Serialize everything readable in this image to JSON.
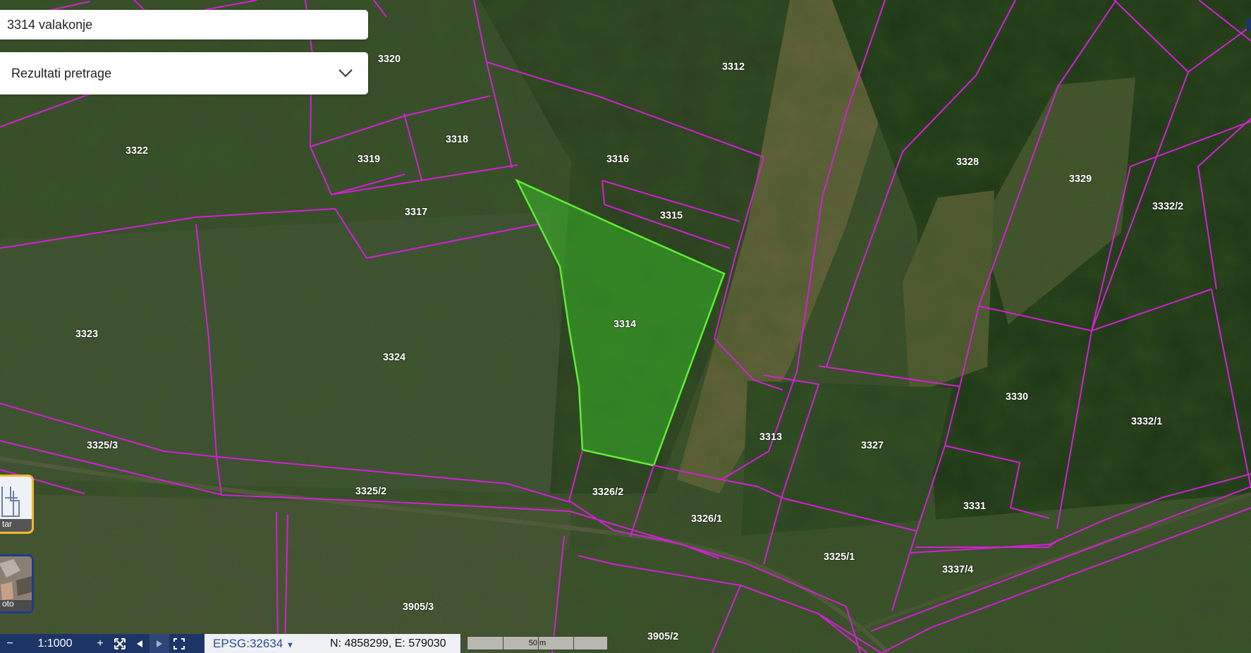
{
  "search": {
    "value": "3314 valakonje"
  },
  "results": {
    "label": "Rezultati pretrage",
    "icon": "chevron-down-icon"
  },
  "parcels": [
    {
      "id": "3320",
      "selected": false
    },
    {
      "id": "3312",
      "selected": false
    },
    {
      "id": "3322",
      "selected": false
    },
    {
      "id": "3318",
      "selected": false
    },
    {
      "id": "3319",
      "selected": false
    },
    {
      "id": "3316",
      "selected": false
    },
    {
      "id": "3328",
      "selected": false
    },
    {
      "id": "3329",
      "selected": false
    },
    {
      "id": "3317",
      "selected": false
    },
    {
      "id": "3315",
      "selected": false
    },
    {
      "id": "3332/2",
      "selected": false
    },
    {
      "id": "3314",
      "selected": true
    },
    {
      "id": "3323",
      "selected": false
    },
    {
      "id": "3324",
      "selected": false
    },
    {
      "id": "3330",
      "selected": false
    },
    {
      "id": "3332/1",
      "selected": false
    },
    {
      "id": "3313",
      "selected": false
    },
    {
      "id": "3325/3",
      "selected": false
    },
    {
      "id": "3327",
      "selected": false
    },
    {
      "id": "3325/2",
      "selected": false
    },
    {
      "id": "3326/2",
      "selected": false
    },
    {
      "id": "3331",
      "selected": false
    },
    {
      "id": "3326/1",
      "selected": false
    },
    {
      "id": "3325/1",
      "selected": false
    },
    {
      "id": "3337/4",
      "selected": false
    },
    {
      "id": "3905/3",
      "selected": false
    },
    {
      "id": "3905/2",
      "selected": false
    }
  ],
  "layers": [
    {
      "label": "tar",
      "active": true
    },
    {
      "label": "oto",
      "active": false
    }
  ],
  "toolbar": {
    "zoom_out": "−",
    "scale": "1:1000",
    "zoom_in": "+",
    "fit": "⛶",
    "prev": "◀",
    "next": "▶",
    "fullscreen": "⛶"
  },
  "projection": {
    "label": "EPSG:32634"
  },
  "coordinates": "N: 4858299, E: 579030",
  "scalebar": {
    "label": "50 m"
  },
  "colors": {
    "parcel_border": "#d41fd6",
    "selected_border": "#5cf033",
    "selected_fill": "#3bd82a",
    "toolbar_bg": "#1d3566",
    "accent": "#f2b92c"
  }
}
